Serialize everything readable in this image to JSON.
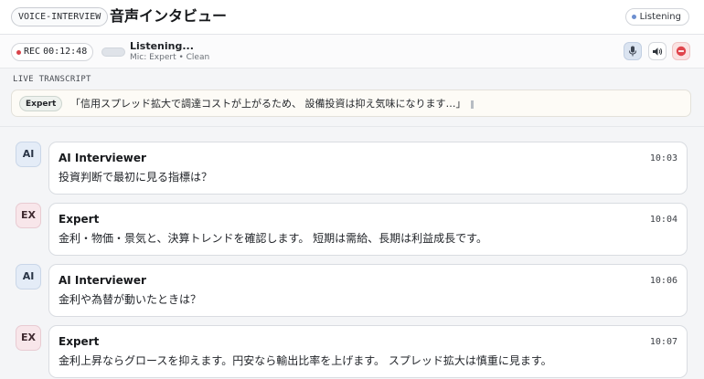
{
  "header": {
    "app_tag": "VOICE-INTERVIEW",
    "title": "音声インタビュー",
    "status": "Listening"
  },
  "recording": {
    "rec_label": "REC",
    "elapsed": "00:12:48",
    "state": "Listening...",
    "detail": "Mic: Expert • Clean"
  },
  "live": {
    "label": "LIVE TRANSCRIPT",
    "speaker": "Expert",
    "text": "「信用スプレッド拡大で調達コストが上がるため、 設備投資は抑え気味になります…」"
  },
  "messages": [
    {
      "avatar": "AI",
      "role": "ai",
      "name": "AI Interviewer",
      "time": "10:03",
      "text": "投資判断で最初に見る指標は？"
    },
    {
      "avatar": "EX",
      "role": "ex",
      "name": "Expert",
      "time": "10:04",
      "text": "金利・物価・景気と、決算トレンドを確認します。 短期は需給、長期は利益成長です。"
    },
    {
      "avatar": "AI",
      "role": "ai",
      "name": "AI Interviewer",
      "time": "10:06",
      "text": "金利や為替が動いたときは？"
    },
    {
      "avatar": "EX",
      "role": "ex",
      "name": "Expert",
      "time": "10:07",
      "text": "金利上昇ならグロースを抑えます。円安なら輸出比率を上げます。 スプレッド拡大は慎重に見ます。"
    }
  ],
  "colors": {
    "rec_dot": "#d9434a",
    "status_dot": "#6d8fd0",
    "ai_avatar_bg": "#e4ecf7",
    "expert_avatar_bg": "#f8e6ea"
  },
  "icons": {
    "mic": "microphone-icon",
    "speaker": "speaker-icon",
    "stop": "stop-icon"
  }
}
